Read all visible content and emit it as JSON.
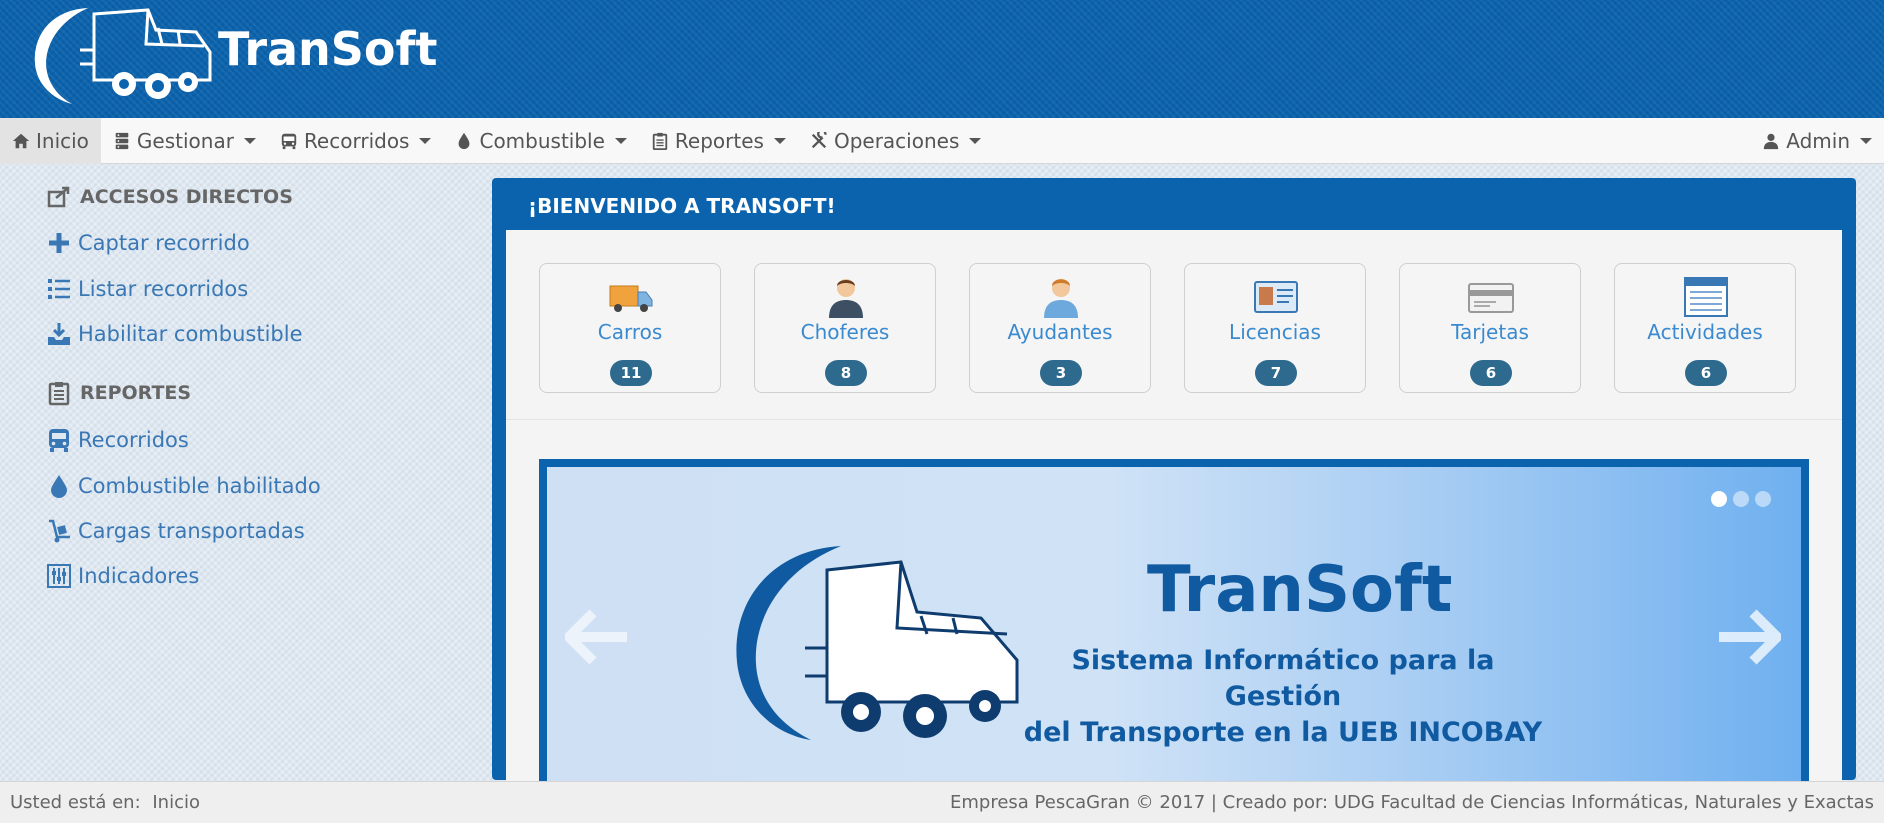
{
  "header": {
    "brand": "TranSoft",
    "logo_icon": "truck-logo-icon"
  },
  "navbar": {
    "items": [
      {
        "label": "Inicio",
        "icon": "home-icon"
      },
      {
        "label": "Gestionar",
        "icon": "database-icon"
      },
      {
        "label": "Recorridos",
        "icon": "bus-icon"
      },
      {
        "label": "Combustible",
        "icon": "drop-icon"
      },
      {
        "label": "Reportes",
        "icon": "clipboard-icon"
      },
      {
        "label": "Operaciones",
        "icon": "tools-icon"
      }
    ],
    "user": {
      "label": "Admin",
      "icon": "user-icon"
    }
  },
  "sidebar": {
    "shortcuts_heading": "ACCESOS DIRECTOS",
    "shortcuts": [
      {
        "label": "Captar recorrido",
        "icon": "plus-icon"
      },
      {
        "label": "Listar recorridos",
        "icon": "list-icon"
      },
      {
        "label": "Habilitar combustible",
        "icon": "download-icon"
      }
    ],
    "reports_heading": "REPORTES",
    "reports": [
      {
        "label": "Recorridos",
        "icon": "bus-icon"
      },
      {
        "label": "Combustible habilitado",
        "icon": "drop-icon"
      },
      {
        "label": "Cargas transportadas",
        "icon": "dolly-icon"
      },
      {
        "label": "Indicadores",
        "icon": "sliders-icon"
      }
    ]
  },
  "main": {
    "title": "¡BIENVENIDO A TRANSOFT!",
    "cards": [
      {
        "label": "Carros",
        "count": "11",
        "icon": "truck-icon"
      },
      {
        "label": "Choferes",
        "count": "8",
        "icon": "driver-icon"
      },
      {
        "label": "Ayudantes",
        "count": "3",
        "icon": "helper-icon"
      },
      {
        "label": "Licencias",
        "count": "7",
        "icon": "license-icon"
      },
      {
        "label": "Tarjetas",
        "count": "6",
        "icon": "card-icon"
      },
      {
        "label": "Actividades",
        "count": "6",
        "icon": "activities-icon"
      }
    ],
    "carousel": {
      "title": "TranSoft",
      "subtitle_line1": "Sistema Informático para la Gestión",
      "subtitle_line2": "del Transporte en la UEB INCOBAY",
      "active_slide": 1,
      "slide_count": 3
    }
  },
  "footer": {
    "location_label": "Usted está en:",
    "location_value": "Inicio",
    "credits": "Empresa PescaGran © 2017 | Creado por: UDG Facultad de Ciencias Informáticas, Naturales y Exactas"
  },
  "colors": {
    "primary": "#0b63ad",
    "link": "#3a78b5",
    "badge": "#2e6a8e"
  }
}
